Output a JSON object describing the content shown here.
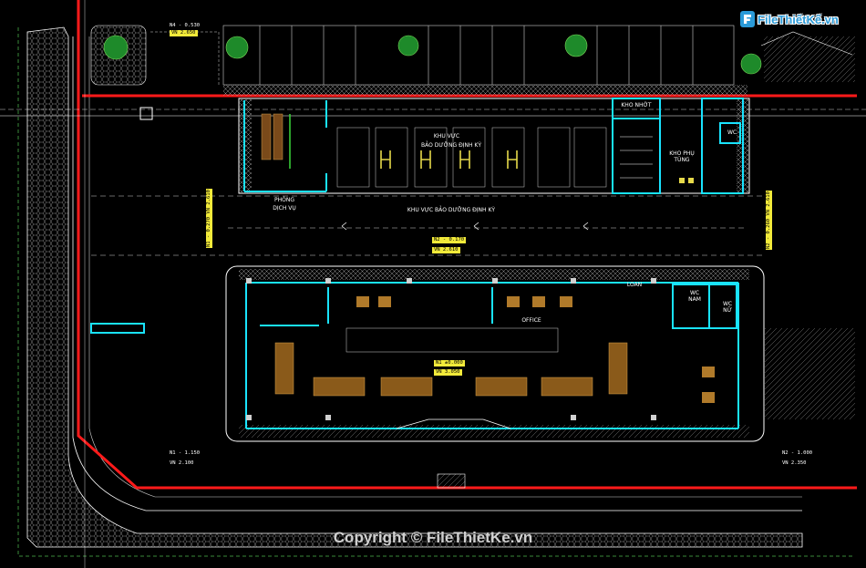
{
  "watermark": {
    "brand": "FileThiếtKế.vn",
    "copyright": "Copyright © FileThietKe.vn",
    "brand_color": "#2a9ad8"
  },
  "rooms": {
    "kho_nhot": "KHO NHỚT",
    "kho_phu_tung": "KHO PHỤ TÙNG",
    "wc_top": "WC",
    "khu_vuc_1": "KHU VỰC",
    "khu_vuc_2": "BẢO DƯỠNG ĐỊNH KỲ",
    "phong_dich_vu_1": "PHÒNG",
    "phong_dich_vu_2": "DỊCH VỤ",
    "khu_vuc_bd": "KHU VỰC BẢO DƯỠNG ĐỊNH KỲ",
    "loan": "LOAN",
    "wc_nam": "WC NAM",
    "wc_nu": "WC NỮ",
    "office": "OFFICE"
  },
  "levels": {
    "n4_top": "N4 - 0.530",
    "n4_bot": "VN  2.650",
    "n1_top": "N1 - 1.150",
    "n1_bot": "VN  2.100",
    "n2_top": "N2 - 1.000",
    "n2_bot": "VN  2.350",
    "center_top": "N2 - 0.170",
    "center_bot": "VN  2.610",
    "n1_main_top": "N1 ±0.000",
    "n1_main_bot": "VN  3.050",
    "left_v": "N1 - 0.270  VN 2.610",
    "right_v": "N2 - 0.260  VN 2.610"
  },
  "colors": {
    "background": "#000000",
    "axis_red": "#ff1a1a",
    "wall_cyan": "#19e3ff",
    "dim_yellow": "#f2ea3a",
    "hatch_grey": "#9a9a9a"
  }
}
